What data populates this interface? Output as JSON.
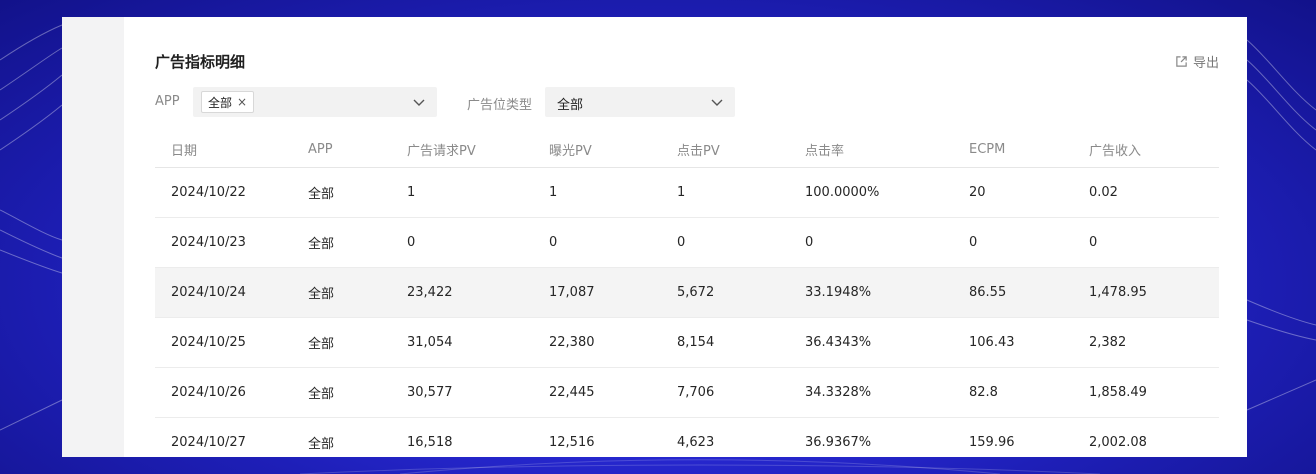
{
  "page": {
    "title": "广告指标明细",
    "export_label": "导出",
    "export_icon": "external-link-icon"
  },
  "filters": {
    "app_label": "APP",
    "app_tag": "全部",
    "app_tag_close": "×",
    "type_label": "广告位类型",
    "type_value": "全部"
  },
  "table": {
    "columns": [
      "日期",
      "APP",
      "广告请求PV",
      "曝光PV",
      "点击PV",
      "点击率",
      "ECPM",
      "广告收入"
    ],
    "rows": [
      [
        "2024/10/22",
        "全部",
        "1",
        "1",
        "1",
        "100.0000%",
        "20",
        "0.02"
      ],
      [
        "2024/10/23",
        "全部",
        "0",
        "0",
        "0",
        "0",
        "0",
        "0"
      ],
      [
        "2024/10/24",
        "全部",
        "23,422",
        "17,087",
        "5,672",
        "33.1948%",
        "86.55",
        "1,478.95"
      ],
      [
        "2024/10/25",
        "全部",
        "31,054",
        "22,380",
        "8,154",
        "36.4343%",
        "106.43",
        "2,382"
      ],
      [
        "2024/10/26",
        "全部",
        "30,577",
        "22,445",
        "7,706",
        "34.3328%",
        "82.8",
        "1,858.49"
      ],
      [
        "2024/10/27",
        "全部",
        "16,518",
        "12,516",
        "4,623",
        "36.9367%",
        "159.96",
        "2,002.08"
      ]
    ],
    "highlighted_row": 2
  },
  "colors": {
    "background": "#2a2bd8",
    "panel": "#ffffff",
    "highlight_row": "#f4f4f4"
  }
}
